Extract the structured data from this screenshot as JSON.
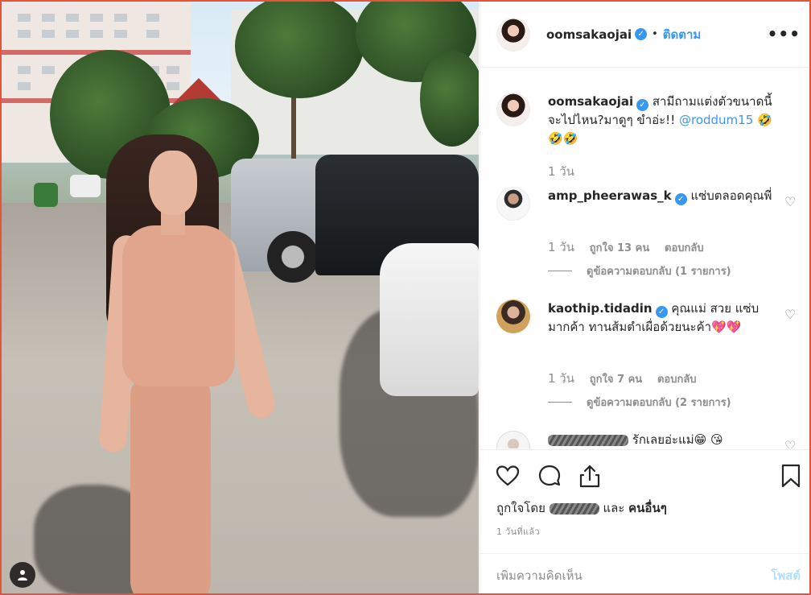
{
  "post": {
    "username": "oomsakaojai",
    "follow_label": "ติดตาม",
    "more_label": "•••"
  },
  "caption": {
    "username": "oomsakaojai",
    "text": "สามีถามแต่งตัวขนาดนี้จะไปไหน?มาดูๆ ขำอ่ะ!! ",
    "mention": "@roddum15",
    "emoji_tail": " 🤣 🤣🤣",
    "time": "1 วัน"
  },
  "comments": [
    {
      "username": "amp_pheerawas_k",
      "text": "แซ่บตลอดคุณพี่",
      "time": "1 วัน",
      "likes": "ถูกใจ 13 คน",
      "reply": "ตอบกลับ",
      "view_replies": "ดูข้อความตอบกลับ (1 รายการ)"
    },
    {
      "username": "kaothip.tidadin",
      "text": "คุณแม่ สวย แซ่บมากค้า ทานส้มตำเผื่อด้วยนะค้า💖💖",
      "time": "1 วัน",
      "likes": "ถูกใจ 7 คน",
      "reply": "ตอบกลับ",
      "view_replies": "ดูข้อความตอบกลับ (2 รายการ)"
    },
    {
      "username": "",
      "text": "รักเลยอ่ะแม่😁 😘"
    }
  ],
  "actions": {
    "liked_by_prefix": "ถูกใจโดย",
    "liked_by_and": "และ",
    "liked_by_others": "คนอื่นๆ",
    "timestamp": "1 วันที่แล้ว"
  },
  "add_comment": {
    "placeholder": "เพิ่มความคิดเห็น",
    "post_label": "โพสต์"
  },
  "colors": {
    "link_blue": "#3897f0",
    "muted": "#8e8e8e",
    "post_disabled": "#b2dffc",
    "frame_red": "#e5533a"
  },
  "icons": [
    "heart-icon",
    "comment-icon",
    "share-icon",
    "bookmark-icon",
    "user-tag-icon",
    "verified-badge-icon",
    "more-options-icon"
  ]
}
